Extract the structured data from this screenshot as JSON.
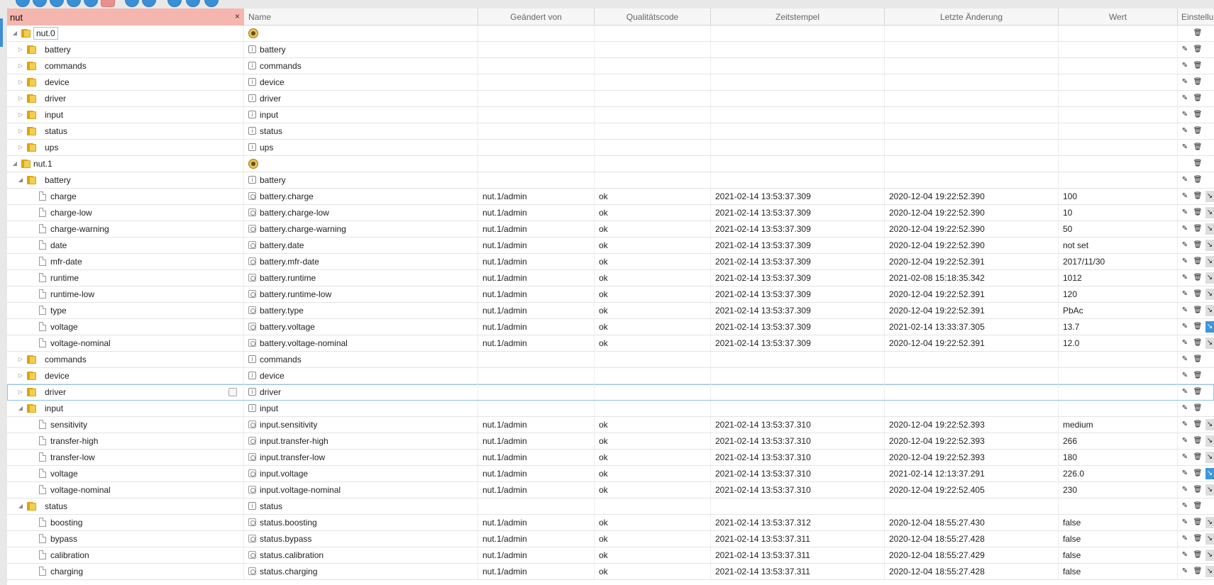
{
  "filter": {
    "value": "nut",
    "clear": "×"
  },
  "columns": {
    "name": "Name",
    "changed_by": "Geändert von",
    "quality": "Qualitätscode",
    "timestamp": "Zeitstempel",
    "last_change": "Letzte Änderung",
    "value": "Wert",
    "settings": "Einstellu"
  },
  "icons": {
    "toggle_open": "◢",
    "toggle_closed": "▷",
    "edit": "✎",
    "delete": "🗑",
    "more": "↘",
    "channel": "i"
  },
  "colors": {
    "filter_bg": "#f4b6ae",
    "accent": "#3d96dd",
    "folder": "#f2cf4d"
  },
  "rows": [
    {
      "indent": 0,
      "toggle": "open",
      "kind": "folder",
      "label": "nut.0",
      "boxed": true,
      "icon": "adapter",
      "name": "",
      "from": "",
      "q": "",
      "ts": "",
      "lc": "",
      "val": "",
      "act": "del"
    },
    {
      "indent": 1,
      "toggle": "closed",
      "kind": "folder",
      "label": "battery",
      "icon": "channel",
      "name": "battery",
      "from": "",
      "q": "",
      "ts": "",
      "lc": "",
      "val": "",
      "act": "ed"
    },
    {
      "indent": 1,
      "toggle": "closed",
      "kind": "folder",
      "label": "commands",
      "icon": "channel",
      "name": "commands",
      "from": "",
      "q": "",
      "ts": "",
      "lc": "",
      "val": "",
      "act": "ed"
    },
    {
      "indent": 1,
      "toggle": "closed",
      "kind": "folder",
      "label": "device",
      "icon": "channel",
      "name": "device",
      "from": "",
      "q": "",
      "ts": "",
      "lc": "",
      "val": "",
      "act": "ed"
    },
    {
      "indent": 1,
      "toggle": "closed",
      "kind": "folder",
      "label": "driver",
      "icon": "channel",
      "name": "driver",
      "from": "",
      "q": "",
      "ts": "",
      "lc": "",
      "val": "",
      "act": "ed"
    },
    {
      "indent": 1,
      "toggle": "closed",
      "kind": "folder",
      "label": "input",
      "icon": "channel",
      "name": "input",
      "from": "",
      "q": "",
      "ts": "",
      "lc": "",
      "val": "",
      "act": "ed"
    },
    {
      "indent": 1,
      "toggle": "closed",
      "kind": "folder",
      "label": "status",
      "icon": "channel",
      "name": "status",
      "from": "",
      "q": "",
      "ts": "",
      "lc": "",
      "val": "",
      "act": "ed"
    },
    {
      "indent": 1,
      "toggle": "closed",
      "kind": "folder",
      "label": "ups",
      "icon": "channel",
      "name": "ups",
      "from": "",
      "q": "",
      "ts": "",
      "lc": "",
      "val": "",
      "act": "ed"
    },
    {
      "indent": 0,
      "toggle": "open",
      "kind": "folder",
      "label": "nut.1",
      "icon": "adapter",
      "name": "",
      "from": "",
      "q": "",
      "ts": "",
      "lc": "",
      "val": "",
      "act": "del"
    },
    {
      "indent": 1,
      "toggle": "open",
      "kind": "folder",
      "label": "battery",
      "icon": "channel",
      "name": "battery",
      "from": "",
      "q": "",
      "ts": "",
      "lc": "",
      "val": "",
      "act": "ed"
    },
    {
      "indent": 2,
      "kind": "file",
      "label": "charge",
      "icon": "state",
      "name": "battery.charge",
      "from": "nut.1/admin",
      "q": "ok",
      "ts": "2021-02-14 13:53:37.309",
      "lc": "2020-12-04 19:22:52.390",
      "val": "100",
      "act": "edm"
    },
    {
      "indent": 2,
      "kind": "file",
      "label": "charge-low",
      "icon": "state",
      "name": "battery.charge-low",
      "from": "nut.1/admin",
      "q": "ok",
      "ts": "2021-02-14 13:53:37.309",
      "lc": "2020-12-04 19:22:52.390",
      "val": "10",
      "act": "edm"
    },
    {
      "indent": 2,
      "kind": "file",
      "label": "charge-warning",
      "icon": "state",
      "name": "battery.charge-warning",
      "from": "nut.1/admin",
      "q": "ok",
      "ts": "2021-02-14 13:53:37.309",
      "lc": "2020-12-04 19:22:52.390",
      "val": "50",
      "act": "edm"
    },
    {
      "indent": 2,
      "kind": "file",
      "label": "date",
      "icon": "state",
      "name": "battery.date",
      "from": "nut.1/admin",
      "q": "ok",
      "ts": "2021-02-14 13:53:37.309",
      "lc": "2020-12-04 19:22:52.390",
      "val": "not set",
      "act": "edm"
    },
    {
      "indent": 2,
      "kind": "file",
      "label": "mfr-date",
      "icon": "state",
      "name": "battery.mfr-date",
      "from": "nut.1/admin",
      "q": "ok",
      "ts": "2021-02-14 13:53:37.309",
      "lc": "2020-12-04 19:22:52.391",
      "val": "2017/11/30",
      "act": "edm"
    },
    {
      "indent": 2,
      "kind": "file",
      "label": "runtime",
      "icon": "state",
      "name": "battery.runtime",
      "from": "nut.1/admin",
      "q": "ok",
      "ts": "2021-02-14 13:53:37.309",
      "lc": "2021-02-08 15:18:35.342",
      "val": "1012",
      "act": "edm"
    },
    {
      "indent": 2,
      "kind": "file",
      "label": "runtime-low",
      "icon": "state",
      "name": "battery.runtime-low",
      "from": "nut.1/admin",
      "q": "ok",
      "ts": "2021-02-14 13:53:37.309",
      "lc": "2020-12-04 19:22:52.391",
      "val": "120",
      "act": "edm"
    },
    {
      "indent": 2,
      "kind": "file",
      "label": "type",
      "icon": "state",
      "name": "battery.type",
      "from": "nut.1/admin",
      "q": "ok",
      "ts": "2021-02-14 13:53:37.309",
      "lc": "2020-12-04 19:22:52.391",
      "val": "PbAc",
      "act": "edm"
    },
    {
      "indent": 2,
      "kind": "file",
      "label": "voltage",
      "icon": "state",
      "name": "battery.voltage",
      "from": "nut.1/admin",
      "q": "ok",
      "ts": "2021-02-14 13:53:37.309",
      "lc": "2021-02-14 13:33:37.305",
      "val": "13.7",
      "act": "edmh"
    },
    {
      "indent": 2,
      "kind": "file",
      "label": "voltage-nominal",
      "icon": "state",
      "name": "battery.voltage-nominal",
      "from": "nut.1/admin",
      "q": "ok",
      "ts": "2021-02-14 13:53:37.309",
      "lc": "2020-12-04 19:22:52.391",
      "val": "12.0",
      "act": "edm"
    },
    {
      "indent": 1,
      "toggle": "closed",
      "kind": "folder",
      "label": "commands",
      "icon": "channel",
      "name": "commands",
      "from": "",
      "q": "",
      "ts": "",
      "lc": "",
      "val": "",
      "act": "ed"
    },
    {
      "indent": 1,
      "toggle": "closed",
      "kind": "folder",
      "label": "device",
      "icon": "channel",
      "name": "device",
      "from": "",
      "q": "",
      "ts": "",
      "lc": "",
      "val": "",
      "act": "ed"
    },
    {
      "indent": 1,
      "toggle": "closed",
      "kind": "folder",
      "label": "driver",
      "icon": "channel",
      "name": "driver",
      "from": "",
      "q": "",
      "ts": "",
      "lc": "",
      "val": "",
      "act": "ed",
      "selected": true
    },
    {
      "indent": 1,
      "toggle": "open",
      "kind": "folder",
      "label": "input",
      "icon": "channel",
      "name": "input",
      "from": "",
      "q": "",
      "ts": "",
      "lc": "",
      "val": "",
      "act": "ed"
    },
    {
      "indent": 2,
      "kind": "file",
      "label": "sensitivity",
      "icon": "state",
      "name": "input.sensitivity",
      "from": "nut.1/admin",
      "q": "ok",
      "ts": "2021-02-14 13:53:37.310",
      "lc": "2020-12-04 19:22:52.393",
      "val": "medium",
      "act": "edm"
    },
    {
      "indent": 2,
      "kind": "file",
      "label": "transfer-high",
      "icon": "state",
      "name": "input.transfer-high",
      "from": "nut.1/admin",
      "q": "ok",
      "ts": "2021-02-14 13:53:37.310",
      "lc": "2020-12-04 19:22:52.393",
      "val": "266",
      "act": "edm"
    },
    {
      "indent": 2,
      "kind": "file",
      "label": "transfer-low",
      "icon": "state",
      "name": "input.transfer-low",
      "from": "nut.1/admin",
      "q": "ok",
      "ts": "2021-02-14 13:53:37.310",
      "lc": "2020-12-04 19:22:52.393",
      "val": "180",
      "act": "edm"
    },
    {
      "indent": 2,
      "kind": "file",
      "label": "voltage",
      "icon": "state",
      "name": "input.voltage",
      "from": "nut.1/admin",
      "q": "ok",
      "ts": "2021-02-14 13:53:37.310",
      "lc": "2021-02-14 12:13:37.291",
      "val": "226.0",
      "act": "edmh"
    },
    {
      "indent": 2,
      "kind": "file",
      "label": "voltage-nominal",
      "icon": "state",
      "name": "input.voltage-nominal",
      "from": "nut.1/admin",
      "q": "ok",
      "ts": "2021-02-14 13:53:37.310",
      "lc": "2020-12-04 19:22:52.405",
      "val": "230",
      "act": "edm"
    },
    {
      "indent": 1,
      "toggle": "open",
      "kind": "folder",
      "label": "status",
      "icon": "channel",
      "name": "status",
      "from": "",
      "q": "",
      "ts": "",
      "lc": "",
      "val": "",
      "act": "ed"
    },
    {
      "indent": 2,
      "kind": "file",
      "label": "boosting",
      "icon": "state",
      "name": "status.boosting",
      "from": "nut.1/admin",
      "q": "ok",
      "ts": "2021-02-14 13:53:37.312",
      "lc": "2020-12-04 18:55:27.430",
      "val": "false",
      "act": "edm"
    },
    {
      "indent": 2,
      "kind": "file",
      "label": "bypass",
      "icon": "state",
      "name": "status.bypass",
      "from": "nut.1/admin",
      "q": "ok",
      "ts": "2021-02-14 13:53:37.311",
      "lc": "2020-12-04 18:55:27.428",
      "val": "false",
      "act": "edm"
    },
    {
      "indent": 2,
      "kind": "file",
      "label": "calibration",
      "icon": "state",
      "name": "status.calibration",
      "from": "nut.1/admin",
      "q": "ok",
      "ts": "2021-02-14 13:53:37.311",
      "lc": "2020-12-04 18:55:27.429",
      "val": "false",
      "act": "edm"
    },
    {
      "indent": 2,
      "kind": "file",
      "label": "charging",
      "icon": "state",
      "name": "status.charging",
      "from": "nut.1/admin",
      "q": "ok",
      "ts": "2021-02-14 13:53:37.311",
      "lc": "2020-12-04 18:55:27.428",
      "val": "false",
      "act": "edm"
    }
  ]
}
